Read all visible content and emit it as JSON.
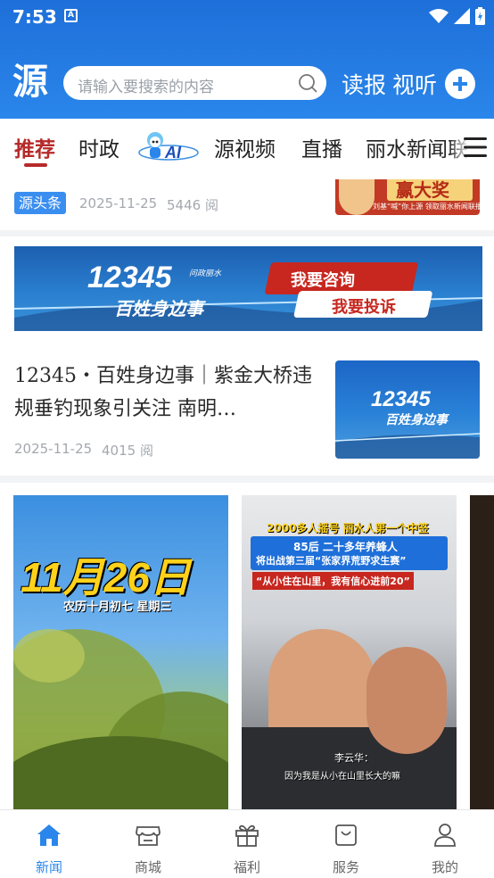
{
  "status": {
    "time": "7:53"
  },
  "header": {
    "logo": "源",
    "search_placeholder": "请输入要搜索的内容",
    "read_paper": "读报",
    "audio_video": "视听"
  },
  "tabs": [
    "推荐",
    "时政",
    "AI",
    "源视频",
    "直播",
    "丽水新闻联播"
  ],
  "feed": {
    "card1": {
      "source": "源头条",
      "date": "2025-11-25",
      "views": "5446 阅",
      "thumb_text": "赢大奖",
      "thumb_caption": "刘基“喊”你上源 领取丽水新闻联播社区奖"
    },
    "banner": {
      "number": "12345",
      "slogan": "百姓身边事",
      "tag": "问政丽水",
      "btn1": "我要咨询",
      "btn2": "我要投诉"
    },
    "article": {
      "title": "12345・百姓身边事｜紫金大桥违规垂钓现象引关注 南明…",
      "date": "2025-11-25",
      "views": "4015 阅",
      "thumb_number": "12345",
      "thumb_slogan": "百姓身边事"
    },
    "videos": [
      {
        "date_big": "11月26日",
        "lunar": "农历十月初七 星期三"
      },
      {
        "line1": "2000多人摇号 丽水人第一个中签",
        "line2": "85后 二十多年养蜂人",
        "line3": "将出战第三届“张家界荒野求生赛”",
        "line4": "“从小住在山里，我有信心进前20”",
        "speaker": "李云华：",
        "subtitle": "因为我是从小在山里长大的嘛"
      }
    ]
  },
  "bottom_nav": [
    {
      "label": "新闻",
      "icon": "home-icon",
      "active": true
    },
    {
      "label": "商城",
      "icon": "store-icon",
      "active": false
    },
    {
      "label": "福利",
      "icon": "gift-icon",
      "active": false
    },
    {
      "label": "服务",
      "icon": "bag-icon",
      "active": false
    },
    {
      "label": "我的",
      "icon": "user-icon",
      "active": false
    }
  ],
  "colors": {
    "brand_blue": "#2a86ea",
    "active_tab": "#b62a2a",
    "badge": "#3a8ef0"
  }
}
